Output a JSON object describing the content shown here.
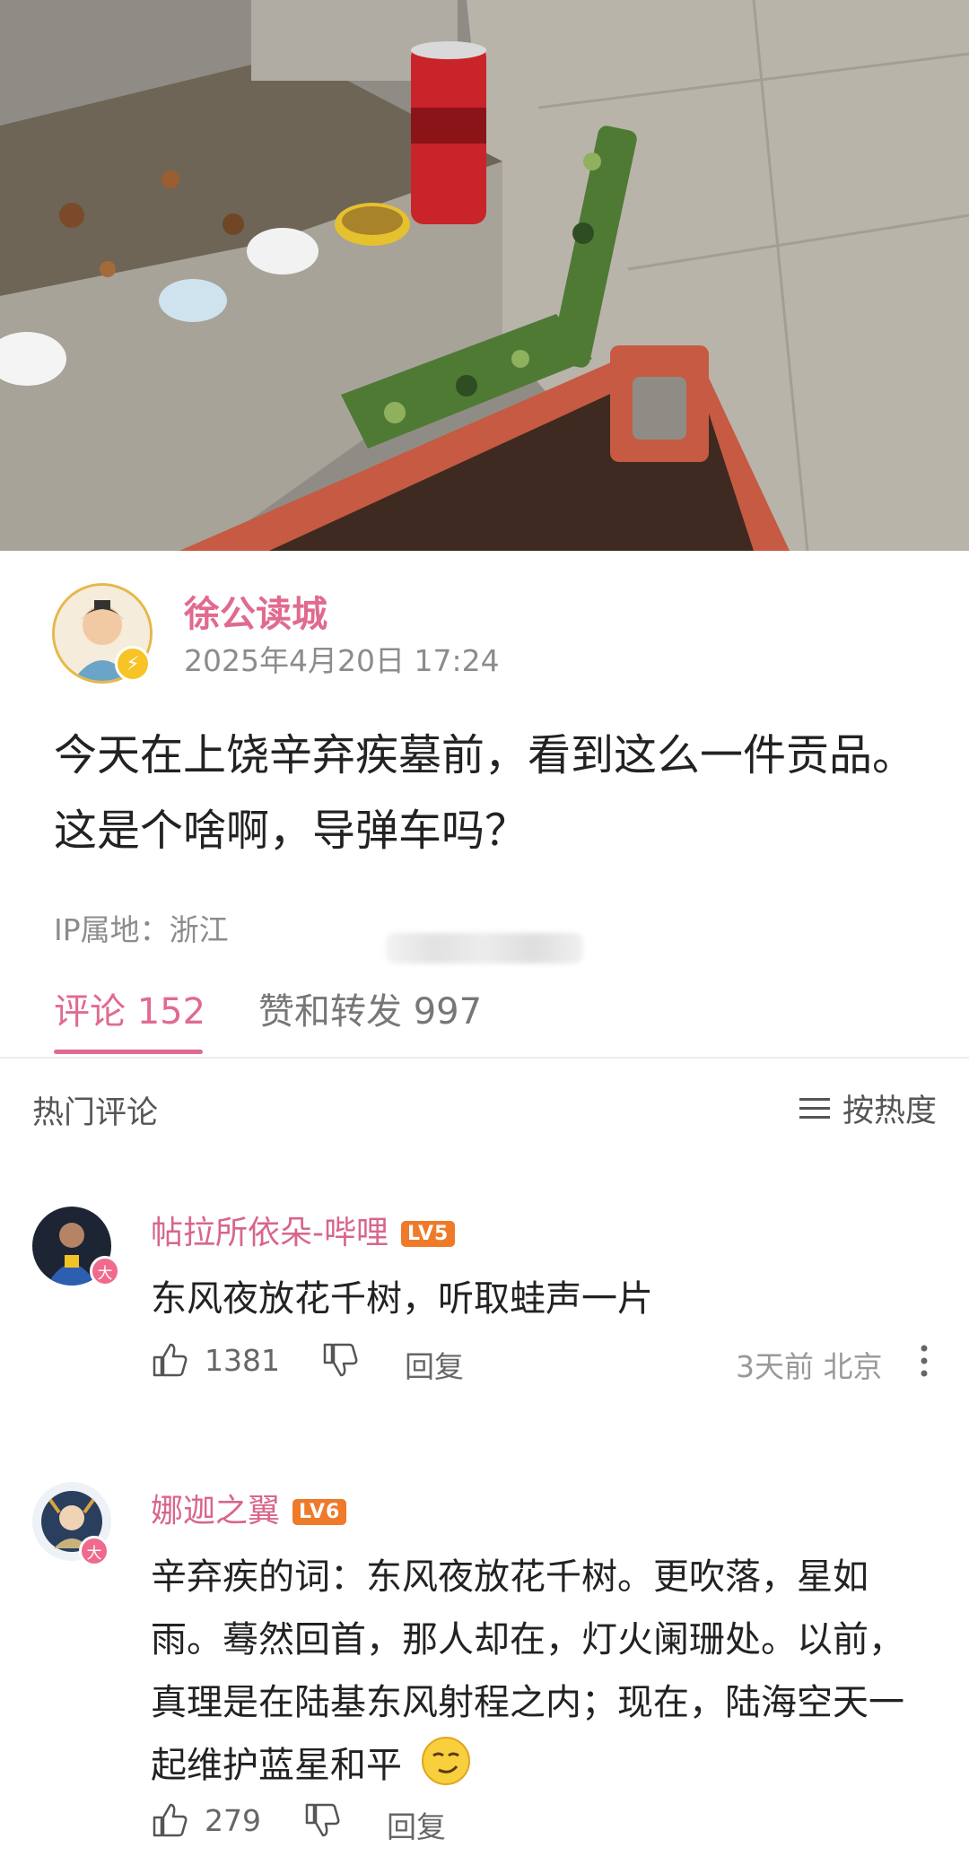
{
  "post": {
    "author": "徐公读城",
    "time": "2025年4月20日 17:24",
    "text": "今天在上饶辛弃疾墓前，看到这么一件贡品。这是个啥啊，导弹车吗？",
    "ip": "IP属地：浙江"
  },
  "tabs": {
    "comments": "评论 152",
    "shares": "赞和转发 997"
  },
  "comments_section": {
    "title": "热门评论",
    "sort_label": "按热度"
  },
  "comments": [
    {
      "name": "帖拉所依朵-哔哩",
      "level": "LV5",
      "badge": "大",
      "text": "东风夜放花千树，听取蛙声一片",
      "likes": "1381",
      "reply": "回复",
      "meta": "3天前 北京"
    },
    {
      "name": "娜迦之翼",
      "level": "LV6",
      "badge": "大",
      "text": "辛弃疾的词：东风夜放花千树。更吹落，星如雨。蓦然回首，那人却在，灯火阑珊处。以前，真理是在陆基东风射程之内；现在，陆海空天一起维护蓝星和平",
      "likes": "279",
      "reply": "回复"
    }
  ],
  "colors": {
    "accent_pink": "#e06b8f",
    "level_orange": "#ee7a2a",
    "verified_yellow": "#f7c325"
  }
}
